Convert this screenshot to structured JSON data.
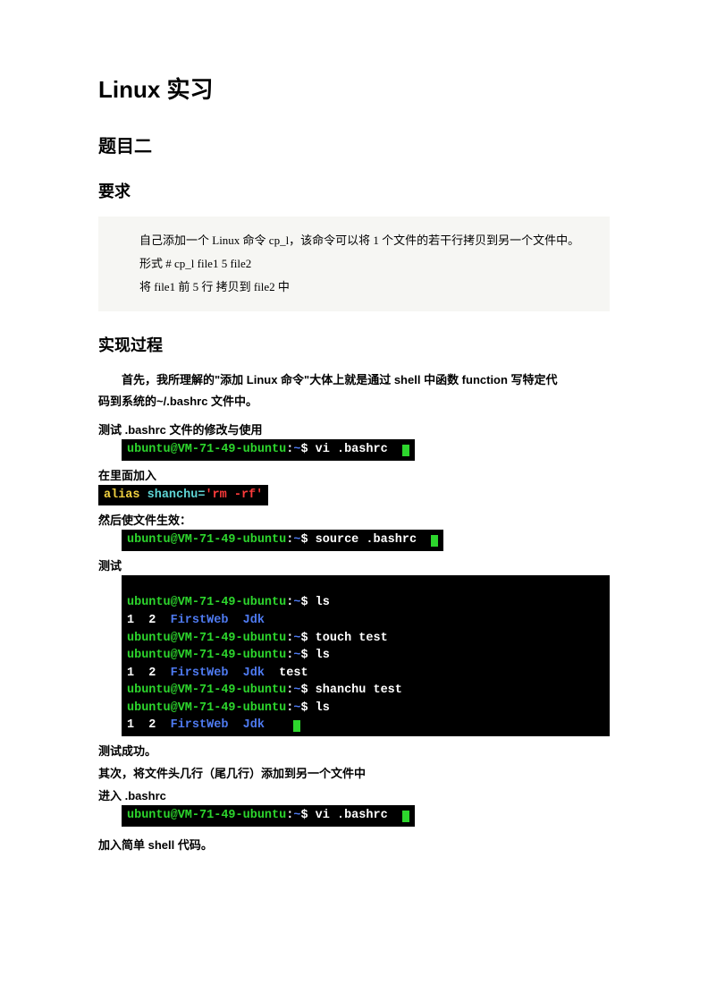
{
  "title": "Linux 实习",
  "sec1": "题目二",
  "sec_req": "要求",
  "req_l1": "自己添加一个 Linux 命令 cp_l，该命令可以将 1 个文件的若干行拷贝到另一个文件中。",
  "req_l2": "形式   # cp_l    file1  5  file2",
  "req_l3": "将 file1 前 5 行    拷贝到 file2 中",
  "sec_impl": "实现过程",
  "impl_intro_p1": "首先，我所理解的\"添加 Linux 命令\"大体上就是通过 shell 中函数 function 写特定代",
  "impl_intro_p2": "码到系统的~/.bashrc 文件中。",
  "lbl_test_bashrc": "测试 .bashrc 文件的修改与使用",
  "lbl_add_inside": "在里面加入",
  "lbl_make_eff": "然后使文件生效：",
  "lbl_test": "测试",
  "lbl_success": "测试成功。",
  "lbl_next": "其次，将文件头几行（尾几行）添加到另一个文件中",
  "lbl_enter": "进入 .bashrc",
  "lbl_add_shell": "加入简单 shell 代码。",
  "term": {
    "prompt_full": "ubuntu@VM-71-49-ubuntu",
    "colon": ":",
    "tilde": "~",
    "dollar": "$",
    "vi_bashrc": " vi .bashrc",
    "alias_kw": "alias",
    "shanchu_eq": " shanchu=",
    "quote": "'",
    "rm_rf": "rm -rf",
    "source_bashrc": " source .bashrc",
    "ls": " ls",
    "touch_test": " touch test",
    "shanchu_test": " shanchu test",
    "listing_12": "1  2  ",
    "firstweb": "FirstWeb",
    "sp2": "  ",
    "jdk": "Jdk",
    "sp2test": "  test"
  }
}
